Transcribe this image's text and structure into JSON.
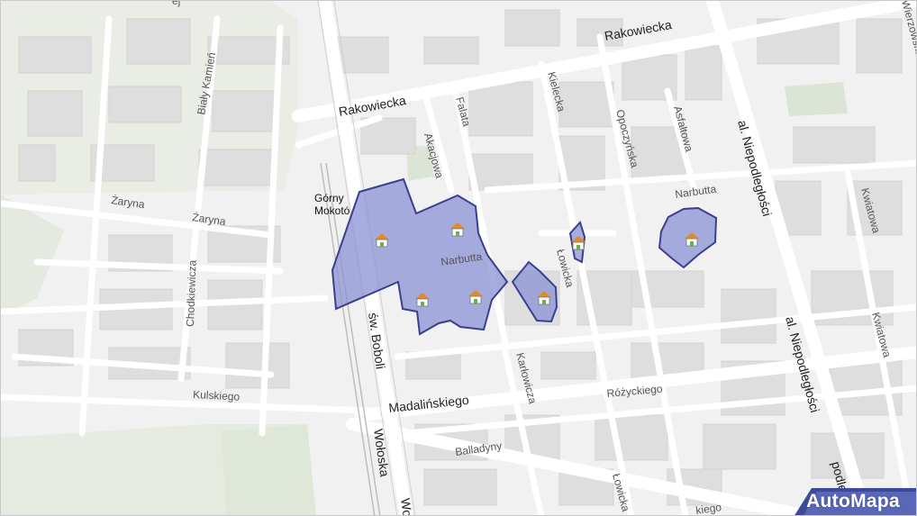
{
  "map": {
    "streets": {
      "rakowiecka_east": "Rakowiecka",
      "rakowiecka_west": "Rakowiecka",
      "bialy_kamien": "Biały Kamień",
      "akacjowa": "Akacjowa",
      "falata": "Falata",
      "kielecka": "Kielecka",
      "opoczynska": "Opoczyńska",
      "asfaltowa": "Asfaltowa",
      "niepodleglosci_north": "al. Niepodległości",
      "niepodleglosci_south": "al. Niepodległości",
      "niepodleglosci_bottom": "podleg",
      "narbutta_east": "Narbutta",
      "narbutta_west": "Narbutta",
      "zaryna_1": "Żaryna",
      "zaryna_2": "Żaryna",
      "chodkiewicza": "Chodkiewicza",
      "boboli": "św. Boboli",
      "lowicka_north": "Łowicka",
      "lowicka_south": "Łowicka",
      "kwiatowa_north": "Kwiatowa",
      "kwiatowa_south": "Kwiatowa",
      "madalinskiego": "Madalińskiego",
      "kulskiego": "Kulskiego",
      "kartowicza": "Karłowicza",
      "rozyckiego": "Różyckiego",
      "woloska": "Wołoska",
      "woloska_2": "Wo",
      "balladyny": "Balladyny",
      "bottom_street": "kiego",
      "top_right": "Wierzowska",
      "top_left": "ej"
    },
    "place_label_line1": "Górny",
    "place_label_line2": "Mokotó",
    "highlight_color": "#8b92d4",
    "highlight_border": "#3b3f8f",
    "marker_icon": "house-icon"
  },
  "brand": {
    "name": "AutoMapa"
  }
}
